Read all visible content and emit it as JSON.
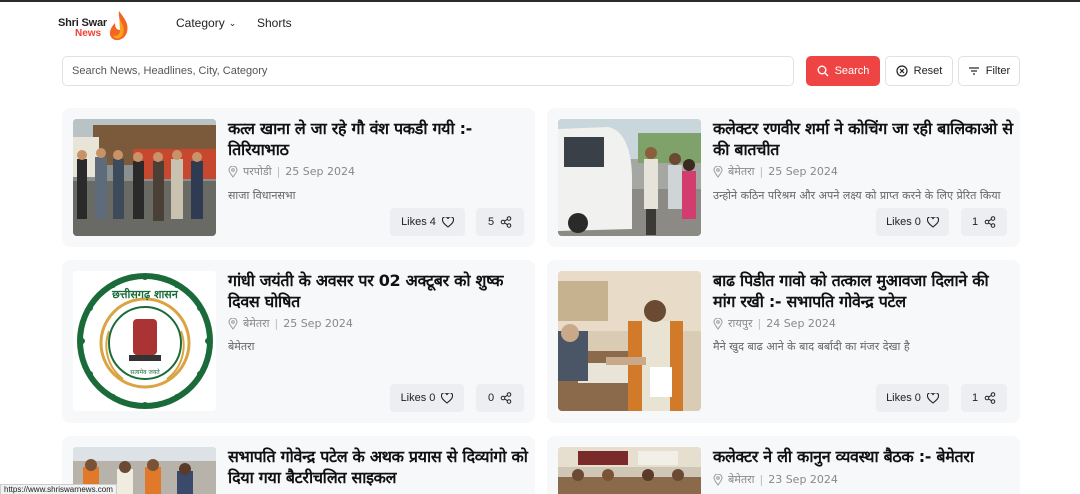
{
  "logo": {
    "line1": "Shri Swar",
    "line2": "News"
  },
  "nav": {
    "category": "Category",
    "shorts": "Shorts"
  },
  "search": {
    "placeholder": "Search News, Headlines, City, Category",
    "search_label": "Search",
    "reset_label": "Reset",
    "filter_label": "Filter"
  },
  "colors": {
    "accent": "#ef4444",
    "card_bg": "#f7f8fa"
  },
  "cards": [
    {
      "title": "कत्ल खाना ले जा रहे गौ वंश पकडी गयी :- तिरियाभाठ",
      "location": "परपोडी",
      "date": "25 Sep 2024",
      "desc": "साजा विधानसभा",
      "likes": "Likes 4",
      "shares": "5"
    },
    {
      "title": "कलेक्टर रणवीर शर्मा ने कोचिंग जा रही बालिकाओ से की बातचीत",
      "location": "बेमेतरा",
      "date": "25 Sep 2024",
      "desc": "उन्होने कठिन परिश्रम और अपने लक्ष्य को प्राप्त करने के लिए प्रेरित किया",
      "likes": "Likes 0",
      "shares": "1"
    },
    {
      "title": "गांधी जयंती के अवसर पर 02 अक्टूबर को शुष्क दिवस घोषित",
      "location": "बेमेतरा",
      "date": "25 Sep 2024",
      "desc": "बेमेतरा",
      "likes": "Likes 0",
      "shares": "0"
    },
    {
      "title": "बाढ पिडीत गावो को तत्काल मुआवजा दिलाने की मांग रखी :- सभापति गोवेन्द्र पटेल",
      "location": "रायपुर",
      "date": "24 Sep 2024",
      "desc": "मैने खुद बाढ आने के बाद बर्बादी का मंजर देखा है",
      "likes": "Likes 0",
      "shares": "1"
    },
    {
      "title": "सभापति गोवेन्द्र पटेल के अथक प्रयास से दिव्यांगो को दिया गया बैटरीचलित साइकल",
      "location": "",
      "date": "",
      "desc": "",
      "likes": "",
      "shares": ""
    },
    {
      "title": "कलेक्टर ने ली कानुन व्यवस्था बैठक :- बेमेतरा",
      "location": "बेमेतरा",
      "date": "23 Sep 2024",
      "desc": "",
      "likes": "",
      "shares": ""
    }
  ],
  "seal": {
    "top_text": "छत्तीसगढ़ शासन",
    "motto": "सत्यमेव जयते"
  },
  "status_url": "https://www.shriswarnews.com"
}
